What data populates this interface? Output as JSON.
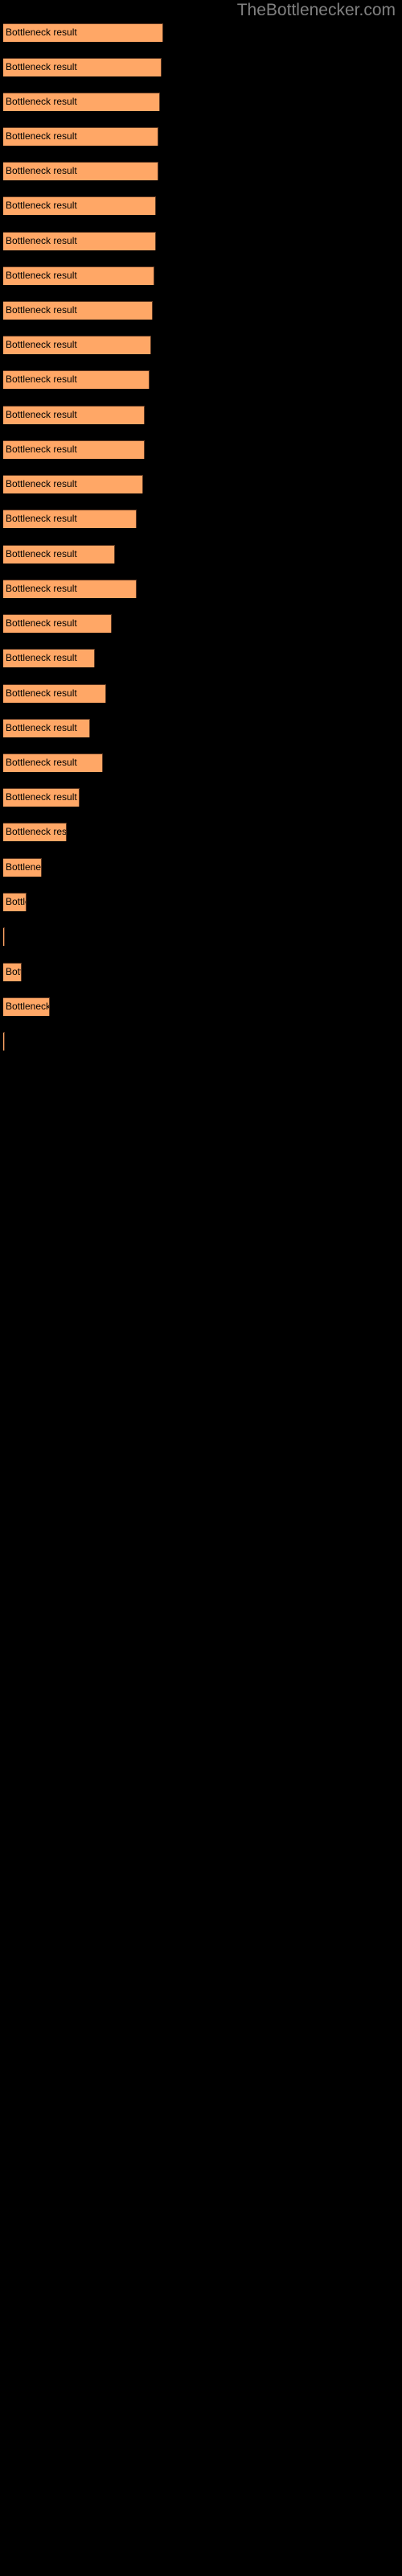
{
  "watermark": {
    "text": "TheBottlenecker.com",
    "color": "#808080"
  },
  "chart_data": {
    "type": "bar",
    "orientation": "horizontal",
    "title": "",
    "subtitle": "",
    "xlabel": "",
    "ylabel": "",
    "grid": false,
    "legend": false,
    "background_color": "#000000",
    "bar_color": "#ffa766",
    "bar_edge_color": "#5a3520",
    "label_color": "#000000",
    "bar_label": "Bottleneck result",
    "xlim": [
      0,
      500
    ],
    "categories": [
      "Bottleneck result",
      "Bottleneck result",
      "Bottleneck result",
      "Bottleneck result",
      "Bottleneck result",
      "Bottleneck result",
      "Bottleneck result",
      "Bottleneck result",
      "Bottleneck result",
      "Bottleneck result",
      "Bottleneck result",
      "Bottleneck result",
      "Bottleneck result",
      "Bottleneck result",
      "Bottleneck result",
      "Bottleneck result",
      "Bottleneck result",
      "Bottleneck result",
      "Bottleneck result",
      "Bottleneck result",
      "Bottleneck result",
      "Bottleneck result",
      "Bottleneck result",
      "Bottleneck result",
      "Bottleneck result",
      "Bottleneck result",
      "Bottleneck result",
      "Bottleneck result",
      "Bottleneck result",
      "Bottleneck result",
      "Bottleneck result"
    ],
    "values": [
      96,
      95,
      94,
      93,
      93,
      92,
      92,
      91,
      90,
      89,
      88,
      85,
      85,
      84,
      80,
      67,
      80,
      65,
      55,
      62,
      52,
      60,
      46,
      38,
      23,
      14,
      1,
      11,
      28,
      1
    ],
    "bars": [
      {
        "label": "Bottleneck result",
        "y": 29,
        "width": 96
      },
      {
        "label": "Bottleneck result",
        "y": 72,
        "width": 95
      },
      {
        "label": "Bottleneck result",
        "y": 115,
        "width": 94
      },
      {
        "label": "Bottleneck result",
        "y": 158,
        "width": 93
      },
      {
        "label": "Bottleneck result",
        "y": 201,
        "width": 93
      },
      {
        "label": "Bottleneck result",
        "y": 244,
        "width": 92
      },
      {
        "label": "Bottleneck result",
        "y": 288,
        "width": 92
      },
      {
        "label": "Bottleneck result",
        "y": 331,
        "width": 91
      },
      {
        "label": "Bottleneck result",
        "y": 374,
        "width": 90
      },
      {
        "label": "Bottleneck result",
        "y": 417,
        "width": 89
      },
      {
        "label": "Bottleneck result",
        "y": 460,
        "width": 88
      },
      {
        "label": "Bottleneck result",
        "y": 504,
        "width": 85
      },
      {
        "label": "Bottleneck result",
        "y": 547,
        "width": 85
      },
      {
        "label": "Bottleneck result",
        "y": 590,
        "width": 84
      },
      {
        "label": "Bottleneck result",
        "y": 633,
        "width": 80
      },
      {
        "label": "Bottleneck result",
        "y": 677,
        "width": 67
      },
      {
        "label": "Bottleneck result",
        "y": 720,
        "width": 80
      },
      {
        "label": "Bottleneck result",
        "y": 763,
        "width": 65
      },
      {
        "label": "Bottleneck result",
        "y": 806,
        "width": 55
      },
      {
        "label": "Bottleneck result",
        "y": 850,
        "width": 62
      },
      {
        "label": "Bottleneck result",
        "y": 893,
        "width": 52
      },
      {
        "label": "Bottleneck result",
        "y": 936,
        "width": 60
      },
      {
        "label": "Bottleneck result",
        "y": 979,
        "width": 46
      },
      {
        "label": "Bottleneck result",
        "y": 1022,
        "width": 38
      },
      {
        "label": "Bottleneck result",
        "y": 1066,
        "width": 23
      },
      {
        "label": "Bottleneck result",
        "y": 1109,
        "width": 14
      },
      {
        "label": "Bottleneck result",
        "y": 1152,
        "width": 1
      },
      {
        "label": "Bottleneck result",
        "y": 1196,
        "width": 11
      },
      {
        "label": "Bottleneck result",
        "y": 1239,
        "width": 28
      },
      {
        "label": "Bottleneck result",
        "y": 1282,
        "width": 1
      }
    ]
  }
}
